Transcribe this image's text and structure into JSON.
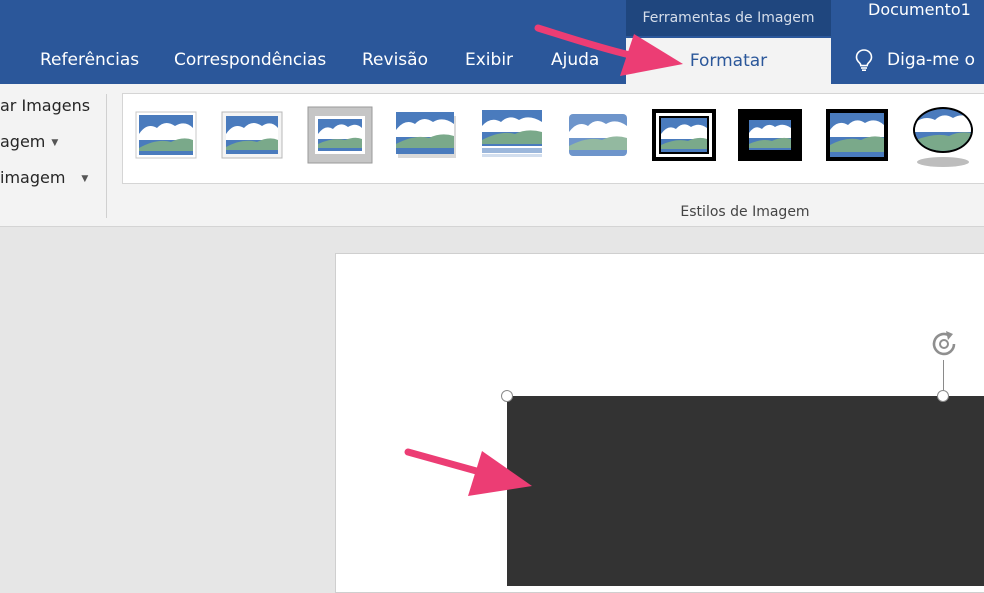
{
  "titlebar": {
    "context_label": "Ferramentas de Imagem",
    "document_title": "Documento1"
  },
  "tabs": [
    {
      "label": "Referências"
    },
    {
      "label": "Correspondências"
    },
    {
      "label": "Revisão"
    },
    {
      "label": "Exibir"
    },
    {
      "label": "Ajuda"
    },
    {
      "label": "Formatar",
      "active": true
    }
  ],
  "tell_me": {
    "label": "Diga-me o",
    "icon": "lightbulb-icon"
  },
  "ribbon": {
    "left_commands": [
      {
        "label": "ar Imagens"
      },
      {
        "label": "agem",
        "dropdown": true
      },
      {
        "label": "imagem",
        "dropdown": true
      }
    ],
    "styles_group": {
      "label": "Estilos de Imagem",
      "style_count": 10,
      "selected_index": 2
    }
  },
  "colors": {
    "ribbon_blue": "#2b579a",
    "context_blue": "#1f467e",
    "annotation_arrow": "#ec3d74",
    "image_fill": "#333333"
  }
}
